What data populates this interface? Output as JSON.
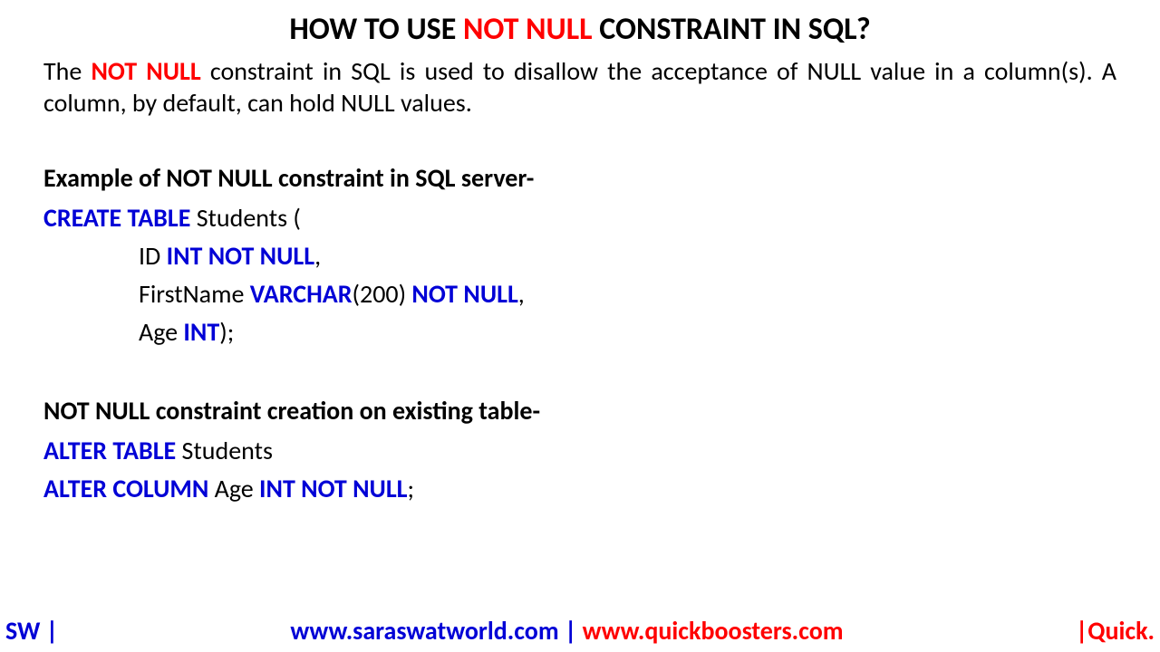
{
  "title": {
    "pre": "HOW TO USE ",
    "highlight": "NOT NULL",
    "post": " CONSTRAINT IN SQL?"
  },
  "description": {
    "pre": "The ",
    "highlight": "NOT NULL",
    "post": " constraint in SQL is used to disallow the acceptance of NULL value in a column(s). A column, by default, can hold NULL values."
  },
  "section1": {
    "heading": "Example of NOT NULL constraint in SQL server-",
    "line1": {
      "kw": "CREATE TABLE",
      "rest": " Students ("
    },
    "line2": {
      "pre": "ID ",
      "kw": "INT NOT NULL",
      "post": ","
    },
    "line3": {
      "pre": "FirstName ",
      "kw1": "VARCHAR",
      "mid": "(200) ",
      "kw2": "NOT NULL",
      "post": ","
    },
    "line4": {
      "pre": "Age ",
      "kw": "INT",
      "post": ");"
    }
  },
  "section2": {
    "heading": "NOT NULL constraint creation on existing table-",
    "line1": {
      "kw": "ALTER TABLE",
      "rest": " Students"
    },
    "line2": {
      "kw1": "ALTER COLUMN",
      "mid": " Age ",
      "kw2": "INT NOT NULL",
      "post": ";"
    }
  },
  "footer": {
    "left": "SW |",
    "center_blue": "www.saraswatworld.com | ",
    "center_red": "www.quickboosters.com",
    "right": "|Quick."
  }
}
